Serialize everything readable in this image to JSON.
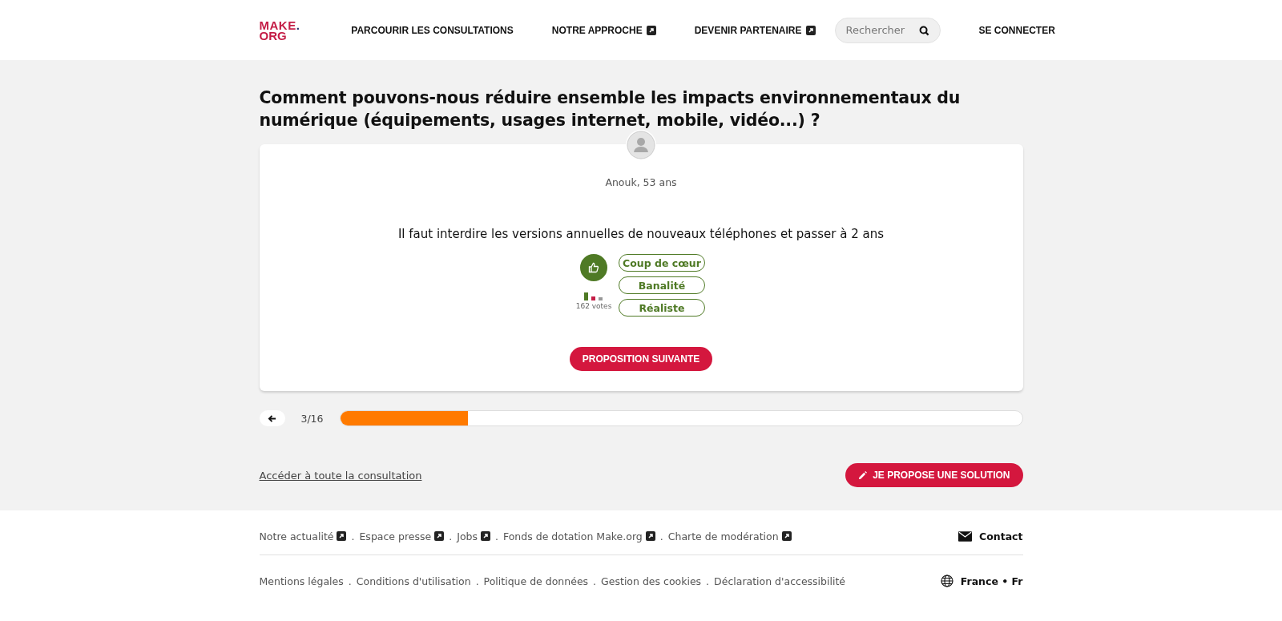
{
  "header": {
    "logo": {
      "line_1": "MAKE",
      "dot": ".",
      "line_2": "ORG"
    },
    "nav": [
      {
        "label": "PARCOURIR LES CONSULTATIONS",
        "external": false
      },
      {
        "label": "NOTRE APPROCHE",
        "external": true
      },
      {
        "label": "DEVENIR PARTENAIRE",
        "external": true
      }
    ],
    "search": {
      "placeholder": "Rechercher"
    },
    "login": "SE CONNECTER"
  },
  "question": "Comment pouvons-nous réduire ensemble les impacts environnementaux du numérique (équipements, usages internet, mobile, vidéo...) ?",
  "proposal": {
    "author": "Anouk, 53 ans",
    "text": "Il faut interdire les versions annuelles de nouveaux téléphones et passer à 2 ans",
    "vote": {
      "selected": true,
      "count": "162 votes"
    },
    "qualifications": [
      {
        "label": "Coup de cœur",
        "selected": false
      },
      {
        "label": "Banalité",
        "selected": false
      },
      {
        "label": "Réaliste",
        "selected": false
      }
    ],
    "next": "PROPOSITION SUIVANTE"
  },
  "progress": {
    "counter": "3/16",
    "level": 0.1875
  },
  "consultation_link": "Accéder à toute la consultation",
  "propose_button": "JE PROPOSE UNE SOLUTION",
  "footer": {
    "links": [
      {
        "label": "Notre actualité",
        "external": true,
        "separator": "."
      },
      {
        "label": "Espace presse",
        "external": true,
        "separator": "."
      },
      {
        "label": "Jobs",
        "external": true,
        "separator": "."
      },
      {
        "label": "Fonds de dotation Make.org",
        "external": true,
        "separator": "."
      },
      {
        "label": "Charte de modération",
        "external": true
      }
    ],
    "contact": "Contact",
    "legal": [
      {
        "label": "Mentions légales",
        "separator": "."
      },
      {
        "label": "Conditions d'utilisation",
        "separator": "."
      },
      {
        "label": "Politique de données",
        "separator": "."
      },
      {
        "label": "Gestion des cookies",
        "separator": "."
      },
      {
        "label": "Déclaration d'accessibilité"
      }
    ],
    "locale": "France • Fr"
  }
}
